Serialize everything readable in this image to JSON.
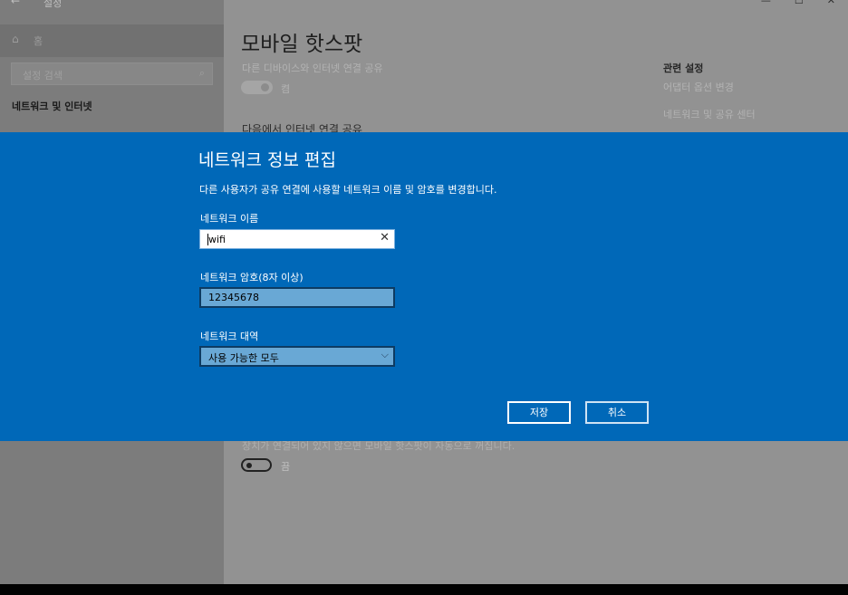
{
  "window": {
    "title": "설정",
    "back_glyph": "←",
    "minimize_glyph": "—",
    "maximize_glyph": "☐",
    "close_glyph": "✕"
  },
  "sidebar": {
    "home_icon": "⌂",
    "home_label": "홈",
    "search_placeholder": "설정 검색",
    "search_icon": "⌕",
    "section_title": "네트워크 및 인터넷"
  },
  "content": {
    "page_title": "모바일 핫스팟",
    "share_label": "다른 디바이스와 인터넷 연결 공유",
    "share_toggle_state": "켬",
    "share_from_label": "다음에서 인터넷 연결 공유",
    "related_title": "관련 설정",
    "related_links": [
      "어댑터 옵션 변경",
      "네트워크 및 공유 센터"
    ],
    "auto_off_text": "장치가 연결되어 있지 않으면 모바일 핫스팟이 자동으로 꺼집니다.",
    "auto_off_toggle_state": "끔"
  },
  "dialog": {
    "title": "네트워크 정보 편집",
    "description": "다른 사용자가 공유 연결에 사용할 네트워크 이름 및 암호를 변경합니다.",
    "name_label": "네트워크 이름",
    "name_value": "wifi",
    "clear_icon": "✕",
    "password_label": "네트워크 암호(8자 이상)",
    "password_value": "12345678",
    "band_label": "네트워크 대역",
    "band_value": "사용 가능한 모두",
    "chevron_icon": "⌵",
    "save_label": "저장",
    "cancel_label": "취소"
  },
  "colors": {
    "dialog_bg": "#0068b8",
    "input_focus_bg": "#ffffff",
    "input_bg": "#69a8d5"
  }
}
